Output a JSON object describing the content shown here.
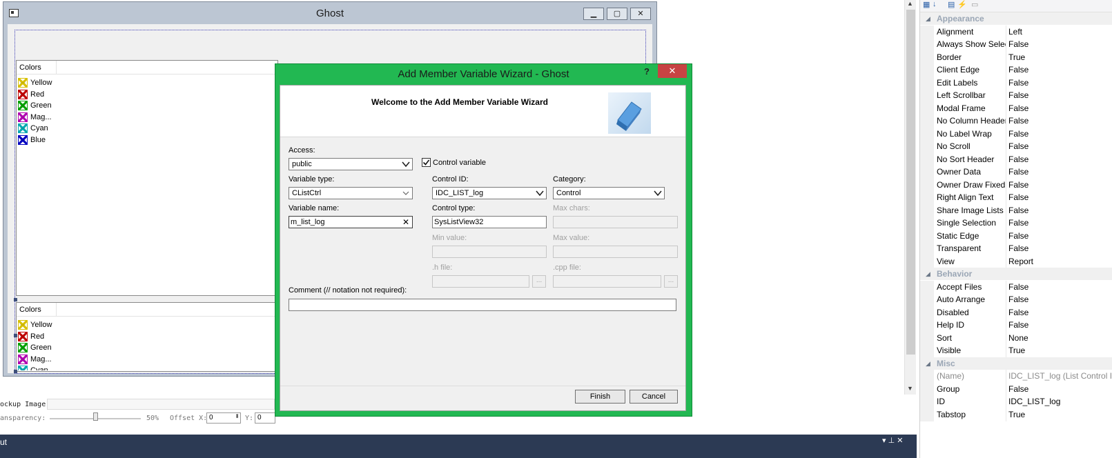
{
  "ghost_window": {
    "title": "Ghost",
    "list1": {
      "header": "Colors",
      "items": [
        {
          "label": "Yellow",
          "color": "#d8c000"
        },
        {
          "label": "Red",
          "color": "#c00000"
        },
        {
          "label": "Green",
          "color": "#00a000"
        },
        {
          "label": "Mag...",
          "color": "#b000b0"
        },
        {
          "label": "Cyan",
          "color": "#00a8b0"
        },
        {
          "label": "Blue",
          "color": "#0000c0"
        }
      ]
    },
    "list2": {
      "header": "Colors",
      "items": [
        {
          "label": "Yellow",
          "color": "#d8c000"
        },
        {
          "label": "Red",
          "color": "#c00000"
        },
        {
          "label": "Green",
          "color": "#00a000"
        },
        {
          "label": "Mag...",
          "color": "#b000b0"
        },
        {
          "label": "Cyan",
          "color": "#00a8b0"
        }
      ]
    }
  },
  "wizard": {
    "title": "Add Member Variable Wizard - Ghost",
    "help": "?",
    "close": "✕",
    "welcome": "Welcome to the Add Member Variable Wizard",
    "access_label": "Access:",
    "access_value": "public",
    "control_variable_label": "Control variable",
    "control_variable_checked": true,
    "variable_type_label": "Variable type:",
    "variable_type_value": "CListCtrl",
    "control_id_label": "Control ID:",
    "control_id_value": "IDC_LIST_log",
    "category_label": "Category:",
    "category_value": "Control",
    "variable_name_label": "Variable name:",
    "variable_name_value": "m_list_log",
    "clear_glyph": "✕",
    "control_type_label": "Control type:",
    "control_type_value": "SysListView32",
    "max_chars_label": "Max chars:",
    "min_value_label": "Min value:",
    "max_value_label": "Max value:",
    "h_file_label": ".h file:",
    "cpp_file_label": ".cpp file:",
    "browse_label": "...",
    "comment_label": "Comment (// notation not required):",
    "finish_label": "Finish",
    "cancel_label": "Cancel"
  },
  "mockup_bar": {
    "image_label": "ockup Image:",
    "transparency_label": "ansparency:",
    "transparency_value": "50%",
    "slider_level": 0.5,
    "offset_x_label": "Offset X:",
    "offset_x_value": "0",
    "y_label": "Y:",
    "y_value": "0"
  },
  "status_bar": {
    "label": "ut",
    "pin_glyphs": "▾ ⊥ ✕"
  },
  "properties": {
    "toolbar_icons": [
      "categorized-icon",
      "alphabetical-icon",
      "properties-icon",
      "events-icon",
      "property-pages-icon"
    ],
    "categories": [
      {
        "name": "Appearance",
        "rows": [
          {
            "name": "Alignment",
            "value": "Left"
          },
          {
            "name": "Always Show Selection",
            "value": "False"
          },
          {
            "name": "Border",
            "value": "True"
          },
          {
            "name": "Client Edge",
            "value": "False"
          },
          {
            "name": "Edit Labels",
            "value": "False"
          },
          {
            "name": "Left Scrollbar",
            "value": "False"
          },
          {
            "name": "Modal Frame",
            "value": "False"
          },
          {
            "name": "No Column Header",
            "value": "False"
          },
          {
            "name": "No Label Wrap",
            "value": "False"
          },
          {
            "name": "No Scroll",
            "value": "False"
          },
          {
            "name": "No Sort Header",
            "value": "False"
          },
          {
            "name": "Owner Data",
            "value": "False"
          },
          {
            "name": "Owner Draw Fixed",
            "value": "False"
          },
          {
            "name": "Right Align Text",
            "value": "False"
          },
          {
            "name": "Share Image Lists",
            "value": "False"
          },
          {
            "name": "Single Selection",
            "value": "False"
          },
          {
            "name": "Static Edge",
            "value": "False"
          },
          {
            "name": "Transparent",
            "value": "False"
          },
          {
            "name": "View",
            "value": "Report"
          }
        ]
      },
      {
        "name": "Behavior",
        "rows": [
          {
            "name": "Accept Files",
            "value": "False"
          },
          {
            "name": "Auto Arrange",
            "value": "False"
          },
          {
            "name": "Disabled",
            "value": "False"
          },
          {
            "name": "Help ID",
            "value": "False"
          },
          {
            "name": "Sort",
            "value": "None"
          },
          {
            "name": "Visible",
            "value": "True"
          }
        ]
      },
      {
        "name": "Misc",
        "rows": [
          {
            "name": "(Name)",
            "value": "IDC_LIST_log (List Control ID)",
            "disabled": true
          },
          {
            "name": "Group",
            "value": "False"
          },
          {
            "name": "ID",
            "value": "IDC_LIST_log"
          },
          {
            "name": "Tabstop",
            "value": "True"
          }
        ]
      }
    ]
  }
}
